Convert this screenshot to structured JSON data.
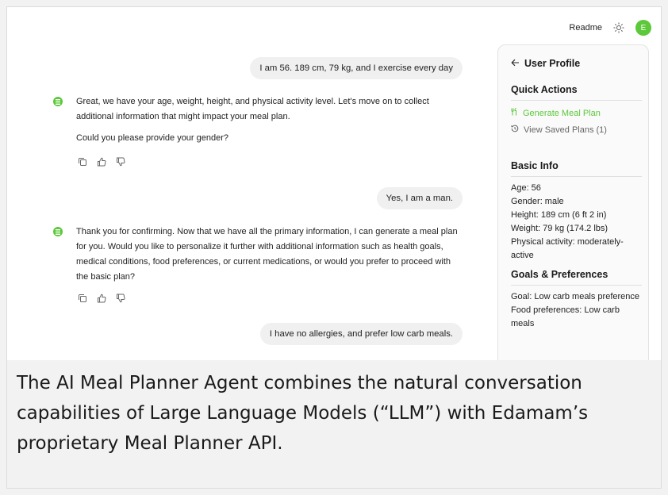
{
  "header": {
    "readme_label": "Readme",
    "theme_icon": "sun-icon",
    "avatar_letter": "E"
  },
  "chat": {
    "user_1": "I am 56. 189 cm, 79 kg, and I exercise every day",
    "ai_1": [
      "Great, we have your age, weight, height, and physical activity level. Let's move on to collect additional information that might impact your meal plan.",
      "Could you please provide your gender?"
    ],
    "user_2": "Yes, I am a man.",
    "ai_2": [
      "Thank you for confirming. Now that we have all the primary information, I can generate a meal plan for you. Would you like to personalize it further with additional information such as health goals, medical conditions, food preferences, or current medications, or would you prefer to proceed with the basic plan?"
    ],
    "user_3": "I have no allergies, and prefer low carb meals.",
    "message_actions": [
      "copy-icon",
      "thumbs-up-icon",
      "thumbs-down-icon"
    ]
  },
  "profile": {
    "title": "User Profile",
    "quick_actions_title": "Quick Actions",
    "generate_label": "Generate Meal Plan",
    "saved_label": "View Saved Plans (1)",
    "basic_info_title": "Basic Info",
    "basic_info": [
      "Age: 56",
      "Gender: male",
      "Height: 189 cm (6 ft 2 in)",
      "Weight: 79 kg (174.2 lbs)",
      "Physical activity: moderately-active"
    ],
    "goals_title": "Goals & Preferences",
    "goals": [
      "Goal: Low carb meals preference",
      "Food preferences: Low carb meals"
    ]
  },
  "caption": "The AI Meal Planner Agent combines the natural conversation capabilities of Large Language Models (“LLM”) with Edamam’s proprietary Meal Planner API.",
  "colors": {
    "accent": "#5cc83a",
    "bubble": "#f0f0f0",
    "panel": "#fafafa"
  }
}
